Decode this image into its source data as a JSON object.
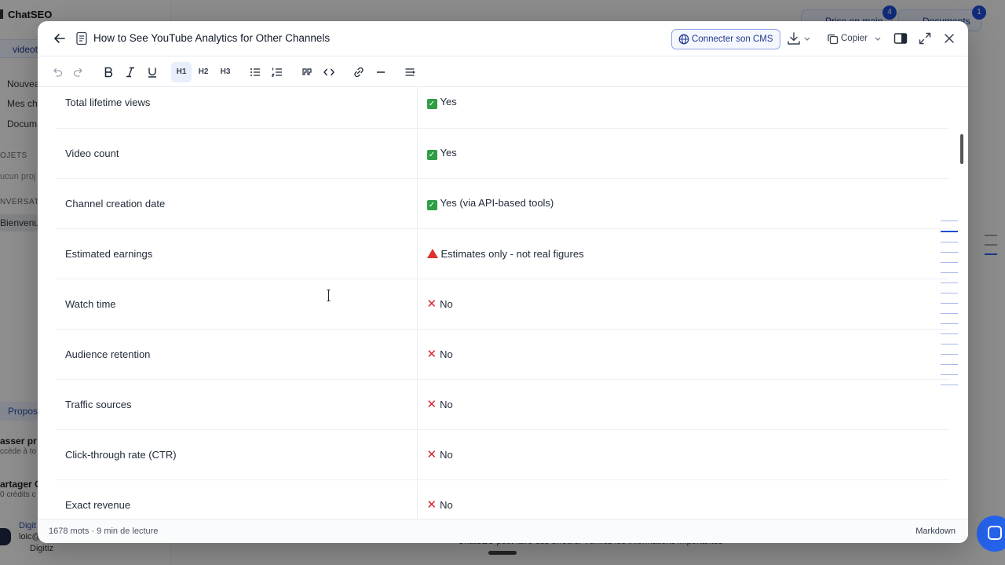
{
  "background": {
    "brand": "ChatSEO",
    "chip_label": "videot",
    "menu_items": [
      "Nouvea",
      "Mes ch",
      "Docum"
    ],
    "projects_label": "OJETS",
    "projects_empty": "ucun proj",
    "conversations_label": "NVERSAT",
    "active_conversation": "Bienvenue",
    "proposals_tab": "Propos",
    "upgrade_title": "asser pr",
    "upgrade_sub": "ccède à to",
    "share_title": "artager C",
    "share_sub": "0 crédits c",
    "user_name": "Digit",
    "user_email": "loic@",
    "user_org": "Digitiz",
    "top_button_1": "Prise en main",
    "top_button_1_badge": "4",
    "top_button_2": "Documents",
    "top_button_2_badge": "1",
    "disclaimer": "ChatSEO peut faire des erreurs. Vérifiez les informations importantes"
  },
  "editor": {
    "title": "How to See YouTube Analytics for Other Channels",
    "cms_button": "Connecter son CMS",
    "copy_button": "Copier",
    "toolbar": {
      "h1": "H1",
      "h2": "H2",
      "h3": "H3"
    },
    "rows": [
      {
        "metric": "Total lifetime views",
        "status": "ok",
        "value": "Yes"
      },
      {
        "metric": "Video count",
        "status": "ok",
        "value": "Yes"
      },
      {
        "metric": "Channel creation date",
        "status": "ok",
        "value": "Yes (via API-based tools)"
      },
      {
        "metric": "Estimated earnings",
        "status": "warn",
        "value": "Estimates only - not real figures"
      },
      {
        "metric": "Watch time",
        "status": "no",
        "value": "No"
      },
      {
        "metric": "Audience retention",
        "status": "no",
        "value": "No"
      },
      {
        "metric": "Traffic sources",
        "status": "no",
        "value": "No"
      },
      {
        "metric": "Click-through rate (CTR)",
        "status": "no",
        "value": "No"
      },
      {
        "metric": "Exact revenue",
        "status": "no",
        "value": "No"
      }
    ],
    "footer_stats": "1678 mots · 9 min de lecture",
    "footer_mode": "Markdown"
  },
  "colors": {
    "accent": "#1d4ed8",
    "ok": "#2f9e44",
    "no": "#d9232e",
    "warn": "#e03131"
  }
}
